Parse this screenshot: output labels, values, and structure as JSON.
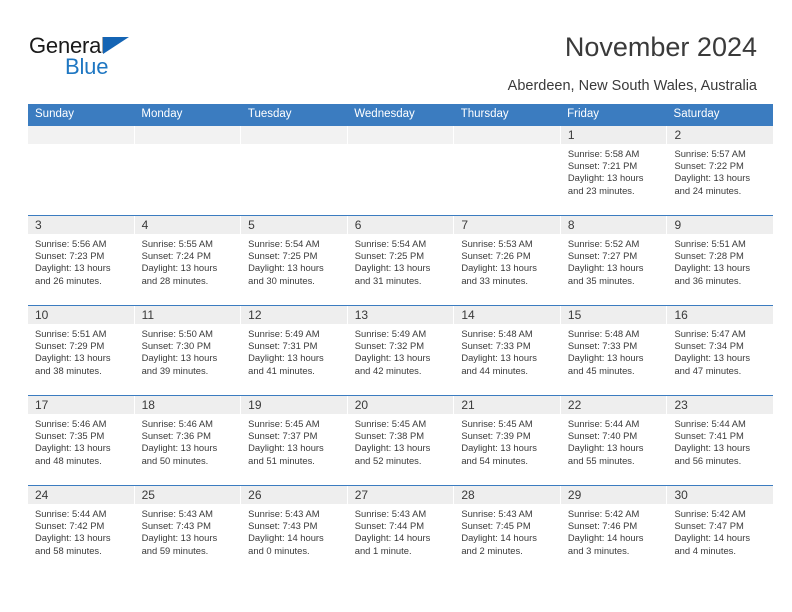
{
  "brand": {
    "name_top": "General",
    "name_bottom": "Blue",
    "accent_color": "#1f77c2",
    "triangle_color": "#1464b4"
  },
  "header": {
    "title": "November 2024",
    "subtitle": "Aberdeen, New South Wales, Australia"
  },
  "theme": {
    "header_blue": "#3b7cc0",
    "daynum_band": "#eeeeee",
    "text": "#3a3a3a"
  },
  "weekdays": [
    "Sunday",
    "Monday",
    "Tuesday",
    "Wednesday",
    "Thursday",
    "Friday",
    "Saturday"
  ],
  "weeks": [
    [
      {
        "day": "",
        "sunrise": "",
        "sunset": "",
        "daylight1": "",
        "daylight2": ""
      },
      {
        "day": "",
        "sunrise": "",
        "sunset": "",
        "daylight1": "",
        "daylight2": ""
      },
      {
        "day": "",
        "sunrise": "",
        "sunset": "",
        "daylight1": "",
        "daylight2": ""
      },
      {
        "day": "",
        "sunrise": "",
        "sunset": "",
        "daylight1": "",
        "daylight2": ""
      },
      {
        "day": "",
        "sunrise": "",
        "sunset": "",
        "daylight1": "",
        "daylight2": ""
      },
      {
        "day": "1",
        "sunrise": "Sunrise: 5:58 AM",
        "sunset": "Sunset: 7:21 PM",
        "daylight1": "Daylight: 13 hours",
        "daylight2": "and 23 minutes."
      },
      {
        "day": "2",
        "sunrise": "Sunrise: 5:57 AM",
        "sunset": "Sunset: 7:22 PM",
        "daylight1": "Daylight: 13 hours",
        "daylight2": "and 24 minutes."
      }
    ],
    [
      {
        "day": "3",
        "sunrise": "Sunrise: 5:56 AM",
        "sunset": "Sunset: 7:23 PM",
        "daylight1": "Daylight: 13 hours",
        "daylight2": "and 26 minutes."
      },
      {
        "day": "4",
        "sunrise": "Sunrise: 5:55 AM",
        "sunset": "Sunset: 7:24 PM",
        "daylight1": "Daylight: 13 hours",
        "daylight2": "and 28 minutes."
      },
      {
        "day": "5",
        "sunrise": "Sunrise: 5:54 AM",
        "sunset": "Sunset: 7:25 PM",
        "daylight1": "Daylight: 13 hours",
        "daylight2": "and 30 minutes."
      },
      {
        "day": "6",
        "sunrise": "Sunrise: 5:54 AM",
        "sunset": "Sunset: 7:25 PM",
        "daylight1": "Daylight: 13 hours",
        "daylight2": "and 31 minutes."
      },
      {
        "day": "7",
        "sunrise": "Sunrise: 5:53 AM",
        "sunset": "Sunset: 7:26 PM",
        "daylight1": "Daylight: 13 hours",
        "daylight2": "and 33 minutes."
      },
      {
        "day": "8",
        "sunrise": "Sunrise: 5:52 AM",
        "sunset": "Sunset: 7:27 PM",
        "daylight1": "Daylight: 13 hours",
        "daylight2": "and 35 minutes."
      },
      {
        "day": "9",
        "sunrise": "Sunrise: 5:51 AM",
        "sunset": "Sunset: 7:28 PM",
        "daylight1": "Daylight: 13 hours",
        "daylight2": "and 36 minutes."
      }
    ],
    [
      {
        "day": "10",
        "sunrise": "Sunrise: 5:51 AM",
        "sunset": "Sunset: 7:29 PM",
        "daylight1": "Daylight: 13 hours",
        "daylight2": "and 38 minutes."
      },
      {
        "day": "11",
        "sunrise": "Sunrise: 5:50 AM",
        "sunset": "Sunset: 7:30 PM",
        "daylight1": "Daylight: 13 hours",
        "daylight2": "and 39 minutes."
      },
      {
        "day": "12",
        "sunrise": "Sunrise: 5:49 AM",
        "sunset": "Sunset: 7:31 PM",
        "daylight1": "Daylight: 13 hours",
        "daylight2": "and 41 minutes."
      },
      {
        "day": "13",
        "sunrise": "Sunrise: 5:49 AM",
        "sunset": "Sunset: 7:32 PM",
        "daylight1": "Daylight: 13 hours",
        "daylight2": "and 42 minutes."
      },
      {
        "day": "14",
        "sunrise": "Sunrise: 5:48 AM",
        "sunset": "Sunset: 7:33 PM",
        "daylight1": "Daylight: 13 hours",
        "daylight2": "and 44 minutes."
      },
      {
        "day": "15",
        "sunrise": "Sunrise: 5:48 AM",
        "sunset": "Sunset: 7:33 PM",
        "daylight1": "Daylight: 13 hours",
        "daylight2": "and 45 minutes."
      },
      {
        "day": "16",
        "sunrise": "Sunrise: 5:47 AM",
        "sunset": "Sunset: 7:34 PM",
        "daylight1": "Daylight: 13 hours",
        "daylight2": "and 47 minutes."
      }
    ],
    [
      {
        "day": "17",
        "sunrise": "Sunrise: 5:46 AM",
        "sunset": "Sunset: 7:35 PM",
        "daylight1": "Daylight: 13 hours",
        "daylight2": "and 48 minutes."
      },
      {
        "day": "18",
        "sunrise": "Sunrise: 5:46 AM",
        "sunset": "Sunset: 7:36 PM",
        "daylight1": "Daylight: 13 hours",
        "daylight2": "and 50 minutes."
      },
      {
        "day": "19",
        "sunrise": "Sunrise: 5:45 AM",
        "sunset": "Sunset: 7:37 PM",
        "daylight1": "Daylight: 13 hours",
        "daylight2": "and 51 minutes."
      },
      {
        "day": "20",
        "sunrise": "Sunrise: 5:45 AM",
        "sunset": "Sunset: 7:38 PM",
        "daylight1": "Daylight: 13 hours",
        "daylight2": "and 52 minutes."
      },
      {
        "day": "21",
        "sunrise": "Sunrise: 5:45 AM",
        "sunset": "Sunset: 7:39 PM",
        "daylight1": "Daylight: 13 hours",
        "daylight2": "and 54 minutes."
      },
      {
        "day": "22",
        "sunrise": "Sunrise: 5:44 AM",
        "sunset": "Sunset: 7:40 PM",
        "daylight1": "Daylight: 13 hours",
        "daylight2": "and 55 minutes."
      },
      {
        "day": "23",
        "sunrise": "Sunrise: 5:44 AM",
        "sunset": "Sunset: 7:41 PM",
        "daylight1": "Daylight: 13 hours",
        "daylight2": "and 56 minutes."
      }
    ],
    [
      {
        "day": "24",
        "sunrise": "Sunrise: 5:44 AM",
        "sunset": "Sunset: 7:42 PM",
        "daylight1": "Daylight: 13 hours",
        "daylight2": "and 58 minutes."
      },
      {
        "day": "25",
        "sunrise": "Sunrise: 5:43 AM",
        "sunset": "Sunset: 7:43 PM",
        "daylight1": "Daylight: 13 hours",
        "daylight2": "and 59 minutes."
      },
      {
        "day": "26",
        "sunrise": "Sunrise: 5:43 AM",
        "sunset": "Sunset: 7:43 PM",
        "daylight1": "Daylight: 14 hours",
        "daylight2": "and 0 minutes."
      },
      {
        "day": "27",
        "sunrise": "Sunrise: 5:43 AM",
        "sunset": "Sunset: 7:44 PM",
        "daylight1": "Daylight: 14 hours",
        "daylight2": "and 1 minute."
      },
      {
        "day": "28",
        "sunrise": "Sunrise: 5:43 AM",
        "sunset": "Sunset: 7:45 PM",
        "daylight1": "Daylight: 14 hours",
        "daylight2": "and 2 minutes."
      },
      {
        "day": "29",
        "sunrise": "Sunrise: 5:42 AM",
        "sunset": "Sunset: 7:46 PM",
        "daylight1": "Daylight: 14 hours",
        "daylight2": "and 3 minutes."
      },
      {
        "day": "30",
        "sunrise": "Sunrise: 5:42 AM",
        "sunset": "Sunset: 7:47 PM",
        "daylight1": "Daylight: 14 hours",
        "daylight2": "and 4 minutes."
      }
    ]
  ]
}
